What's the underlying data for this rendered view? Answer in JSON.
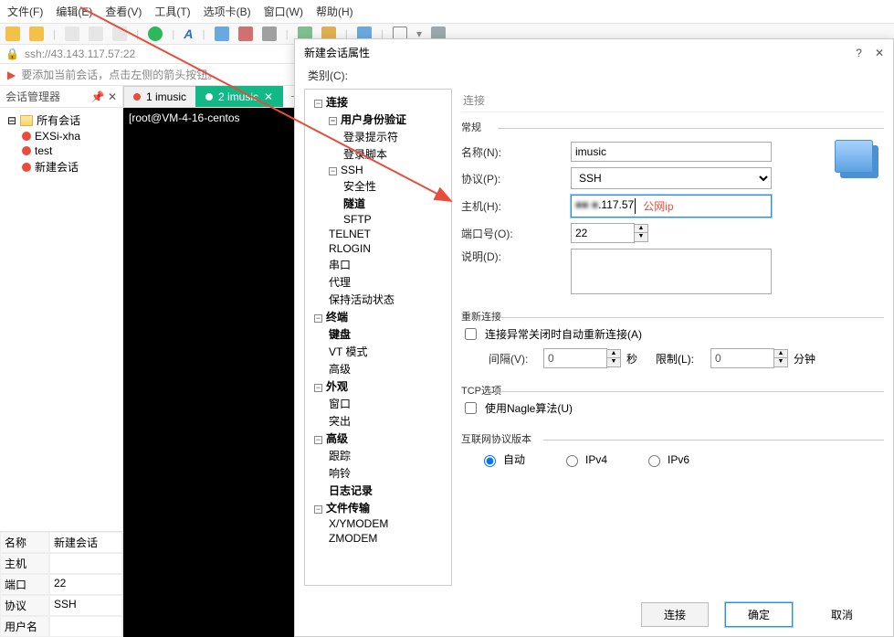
{
  "menu": [
    "文件(F)",
    "编辑(E)",
    "查看(V)",
    "工具(T)",
    "选项卡(B)",
    "窗口(W)",
    "帮助(H)"
  ],
  "address": "ssh://43.143.117.57:22",
  "hint_text": "要添加当前会话，点击左侧的箭头按钮。",
  "session_panel": {
    "title": "会话管理器",
    "root": "所有会话",
    "items": [
      "EXSi-xha",
      "test",
      "新建会话"
    ]
  },
  "props": {
    "name_k": "名称",
    "name_v": "新建会话",
    "host_k": "主机",
    "host_v": "",
    "port_k": "端口",
    "port_v": "22",
    "proto_k": "协议",
    "proto_v": "SSH",
    "user_k": "用户名",
    "user_v": ""
  },
  "tabs": {
    "t1": "1 imusic",
    "t2": "2 imusic"
  },
  "terminal_line": "[root@VM-4-16-centos",
  "dialog": {
    "title": "新建会话属性",
    "cat_label": "类别(C):",
    "tree": {
      "conn": "连接",
      "auth": "用户身份验证",
      "login_prompt": "登录提示符",
      "login_sc": "登录脚本",
      "ssh": "SSH",
      "sec": "安全性",
      "tunnel": "隧道",
      "sftp": "SFTP",
      "telnet": "TELNET",
      "rlogin": "RLOGIN",
      "serial": "串口",
      "proxy": "代理",
      "keep": "保持活动状态",
      "term": "终端",
      "kb": "键盘",
      "vt": "VT 模式",
      "adv1": "高级",
      "look": "外观",
      "win": "窗口",
      "popup": "突出",
      "adv": "高级",
      "trace": "跟踪",
      "bell": "响铃",
      "log": "日志记录",
      "ft": "文件传输",
      "xy": "X/YMODEM",
      "zm": "ZMODEM"
    },
    "right_head": "连接",
    "g_general": "常规",
    "lbl_name": "名称(N):",
    "val_name": "imusic",
    "lbl_proto": "协议(P):",
    "val_proto": "SSH",
    "lbl_host": "主机(H):",
    "val_host": ".117.57",
    "val_host_prefix": "■■ ■",
    "annot": "公网ip",
    "lbl_port": "端口号(O):",
    "val_port": "22",
    "lbl_desc": "说明(D):",
    "g_reconn": "重新连接",
    "chk_reconn": "连接异常关闭时自动重新连接(A)",
    "lbl_interval": "间隔(V):",
    "val_interval": "0",
    "sec": "秒",
    "lbl_limit": "限制(L):",
    "val_limit": "0",
    "min": "分钟",
    "g_tcp": "TCP选项",
    "chk_nagle": "使用Nagle算法(U)",
    "g_ip": "互联网协议版本",
    "r_auto": "自动",
    "r_v4": "IPv4",
    "r_v6": "IPv6",
    "btn_connect": "连接",
    "btn_ok": "确定",
    "btn_cancel": "取消"
  }
}
